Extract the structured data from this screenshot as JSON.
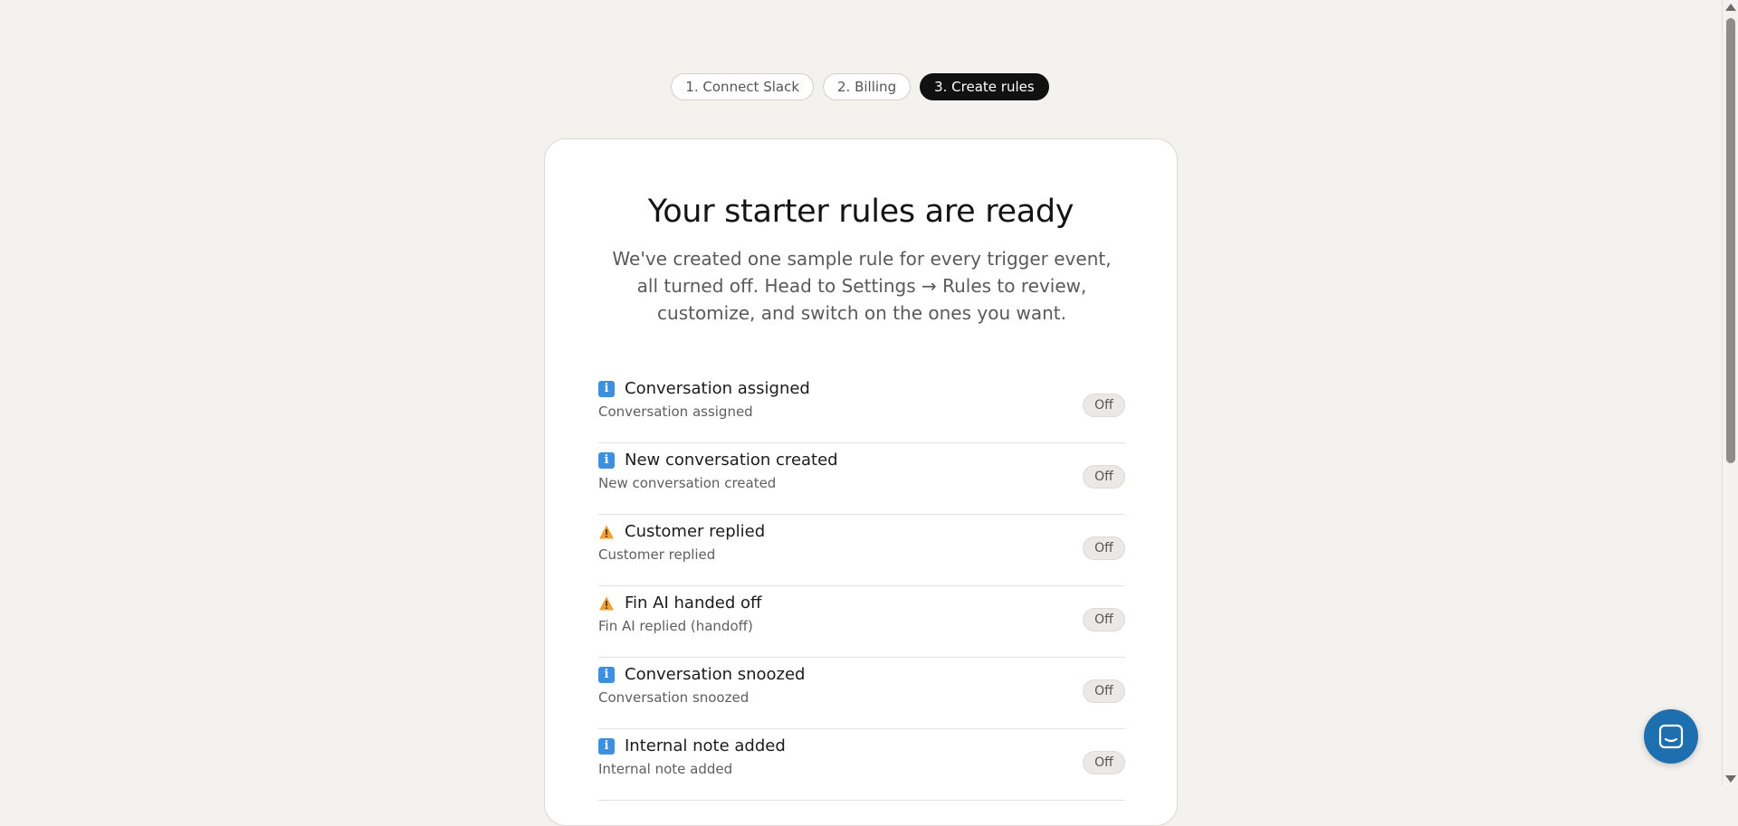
{
  "stepper": {
    "steps": [
      {
        "label": "1. Connect Slack",
        "active": false
      },
      {
        "label": "2. Billing",
        "active": false
      },
      {
        "label": "3. Create rules",
        "active": true
      }
    ]
  },
  "card": {
    "title": "Your starter rules are ready",
    "subtitle": "We've created one sample rule for every trigger event, all turned off. Head to Settings → Rules to review, customize, and switch on the ones you want.",
    "rules": [
      {
        "icon": "info-icon",
        "title": "Conversation assigned",
        "event": "Conversation assigned",
        "status": "Off"
      },
      {
        "icon": "warning-icon",
        "title": "New conversation created",
        "event": "New conversation created",
        "status": "Off"
      },
      {
        "icon": "warning-icon",
        "title": "Customer replied",
        "event": "Customer replied",
        "status": "Off"
      },
      {
        "icon": "warning-icon",
        "title": "Fin AI handed off",
        "event": "Fin AI replied (handoff)",
        "status": "Off"
      },
      {
        "icon": "info-icon",
        "title": "Conversation snoozed",
        "event": "Conversation snoozed",
        "status": "Off"
      },
      {
        "icon": "info-icon",
        "title": "Internal note added",
        "event": "Internal note added",
        "status": "Off"
      }
    ]
  },
  "colors": {
    "background": "#f4f2ee",
    "active_step": "#111111",
    "info_icon": "#3d8fe0",
    "warning_icon": "#f0a032",
    "chat_launcher": "#1e6fb0"
  }
}
